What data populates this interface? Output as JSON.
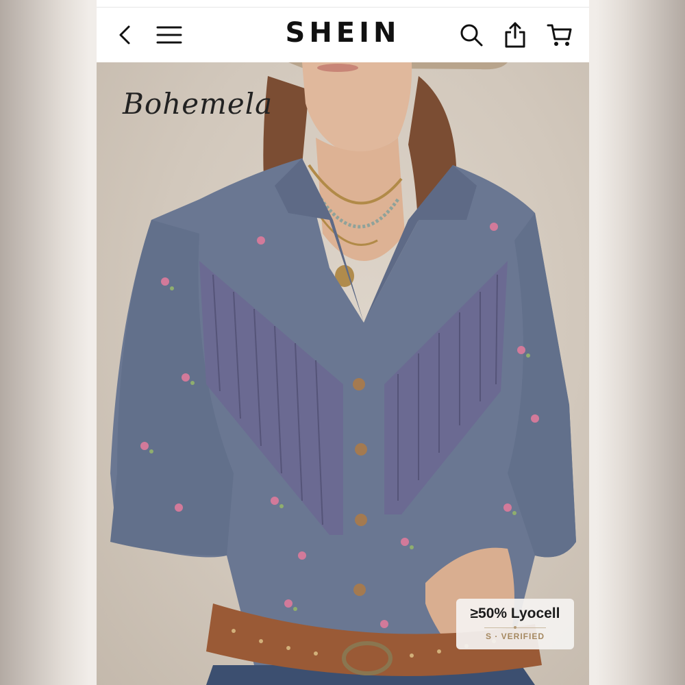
{
  "nav": {
    "back_icon": "chevron-left-icon",
    "menu_icon": "hamburger-menu-icon",
    "brand": "SHEIN",
    "search_icon": "search-icon",
    "share_icon": "share-icon",
    "cart_icon": "cart-icon"
  },
  "product": {
    "brand_logo": "Bohemela",
    "material_badge": "≥50% Lyocell",
    "badge_sub": "S · VERIFIED"
  },
  "colors": {
    "brand": "#111111",
    "badge_accent": "#a58860",
    "denim": "#6a7792",
    "fringe": "#6b6a92",
    "belt": "#9a5a36"
  }
}
